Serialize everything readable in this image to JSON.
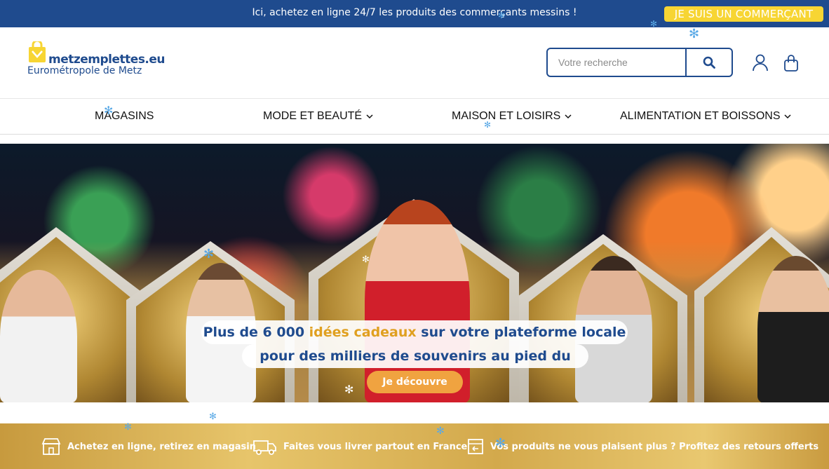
{
  "topbar": {
    "message": "Ici, achetez en ligne 24/7 les produits des commerçants messins !",
    "merchant_button": "JE SUIS UN COMMERÇANT"
  },
  "header": {
    "logo_name": "metzemplettes.eu",
    "logo_subtitle": "Eurométropole de Metz",
    "search_placeholder": "Votre recherche",
    "icons": [
      "search-icon",
      "user-icon",
      "shopping-bag-icon"
    ]
  },
  "nav": {
    "items": [
      {
        "label": "MAGASINS",
        "has_dropdown": false
      },
      {
        "label": "MODE ET BEAUTÉ",
        "has_dropdown": true
      },
      {
        "label": "MAISON ET LOISIRS",
        "has_dropdown": true
      },
      {
        "label": "ALIMENTATION ET BOISSONS",
        "has_dropdown": true
      }
    ]
  },
  "hero": {
    "line1_a": "Plus de 6 000 ",
    "line1_highlight": "idées cadeaux",
    "line1_b": " sur votre plateforme locale",
    "line2": "pour des milliers de souvenirs au pied du sapin !",
    "cta": "Je découvre"
  },
  "features": [
    {
      "icon": "store-icon",
      "label": "Achetez en ligne, retirez en magasin"
    },
    {
      "icon": "delivery-truck-icon",
      "label": "Faites vous livrer partout en France"
    },
    {
      "icon": "return-box-icon",
      "label": "Vos produits ne vous plaisent plus ? Profitez des retours offerts"
    }
  ],
  "colors": {
    "brand_blue": "#1f4b8e",
    "brand_yellow": "#f7d533",
    "gold": "#d3a94c"
  }
}
